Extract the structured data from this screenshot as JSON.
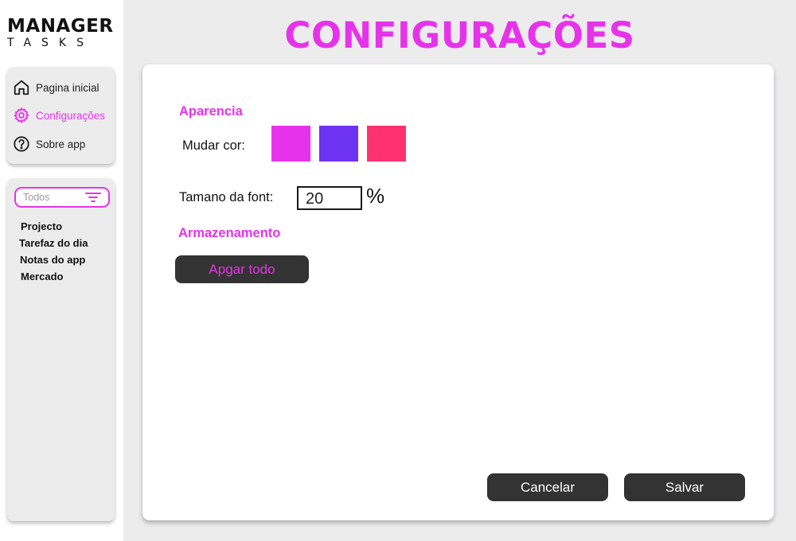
{
  "app": {
    "logo_main": "MANAGER",
    "logo_sub": "TASKS"
  },
  "nav": {
    "items": [
      {
        "label": "Pagina inicial",
        "icon": "home-icon",
        "active": false
      },
      {
        "label": "Configurações",
        "icon": "gear-icon",
        "active": true
      },
      {
        "label": "Sobre app",
        "icon": "help-icon",
        "active": false
      }
    ]
  },
  "filter": {
    "value": "Todos",
    "icon": "filter-icon"
  },
  "lists": [
    "Projecto",
    "Tarefaz do dia",
    "Notas do app",
    "Mercado"
  ],
  "page": {
    "title": "CONFIGURAÇÕES"
  },
  "appearance": {
    "section_title": "Aparencia",
    "color_label": "Mudar cor:",
    "colors": [
      "#e633e9",
      "#6c33f0",
      "#ff3270"
    ],
    "font_label": "Tamano da font:",
    "font_value": "20",
    "font_unit": "%"
  },
  "storage": {
    "section_title": "Armazenamento",
    "delete_label": "Apgar todo"
  },
  "actions": {
    "cancel_label": "Cancelar",
    "save_label": "Salvar"
  },
  "theme": {
    "accent": "#e633e9",
    "dark_button": "#333333",
    "background": "#ececed"
  }
}
